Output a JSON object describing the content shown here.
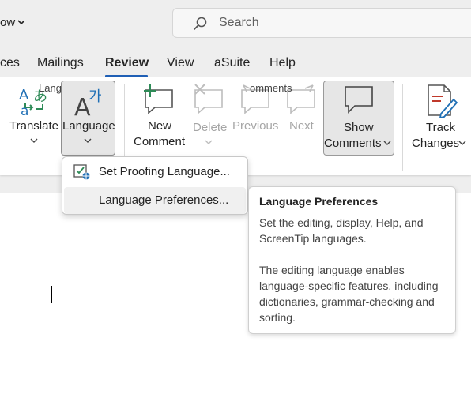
{
  "titlebar": {
    "quick_access_fragment": "ow",
    "search_placeholder": "Search"
  },
  "tabs": [
    {
      "label": "ces"
    },
    {
      "label": "Mailings"
    },
    {
      "label": "Review",
      "active": true
    },
    {
      "label": "View"
    },
    {
      "label": "aSuite"
    },
    {
      "label": "Help"
    }
  ],
  "ribbon": {
    "translate_label": "Translate",
    "language_label": "Language",
    "language_group_label": "Lang",
    "new_comment_line1": "New",
    "new_comment_line2": "Comment",
    "delete_label": "Delete",
    "previous_label": "Previous",
    "next_label": "Next",
    "show_comments_line1": "Show",
    "show_comments_line2": "Comments",
    "comments_group_label": "omments",
    "track_changes_line1": "Track",
    "track_changes_line2": "Changes"
  },
  "language_menu": {
    "items": [
      {
        "label": "Set Proofing Language..."
      },
      {
        "label": "Language Preferences..."
      }
    ]
  },
  "tooltip": {
    "title": "Language Preferences",
    "para1": "Set the editing, display, Help, and ScreenTip languages.",
    "para2": "The editing language enables language-specific features, including dictionaries, grammar-checking and sorting."
  },
  "colors": {
    "accent": "#1f5fb5",
    "comment_green": "#2e8b57",
    "translate_blue": "#1f6fb5",
    "track_red": "#c0392b"
  }
}
